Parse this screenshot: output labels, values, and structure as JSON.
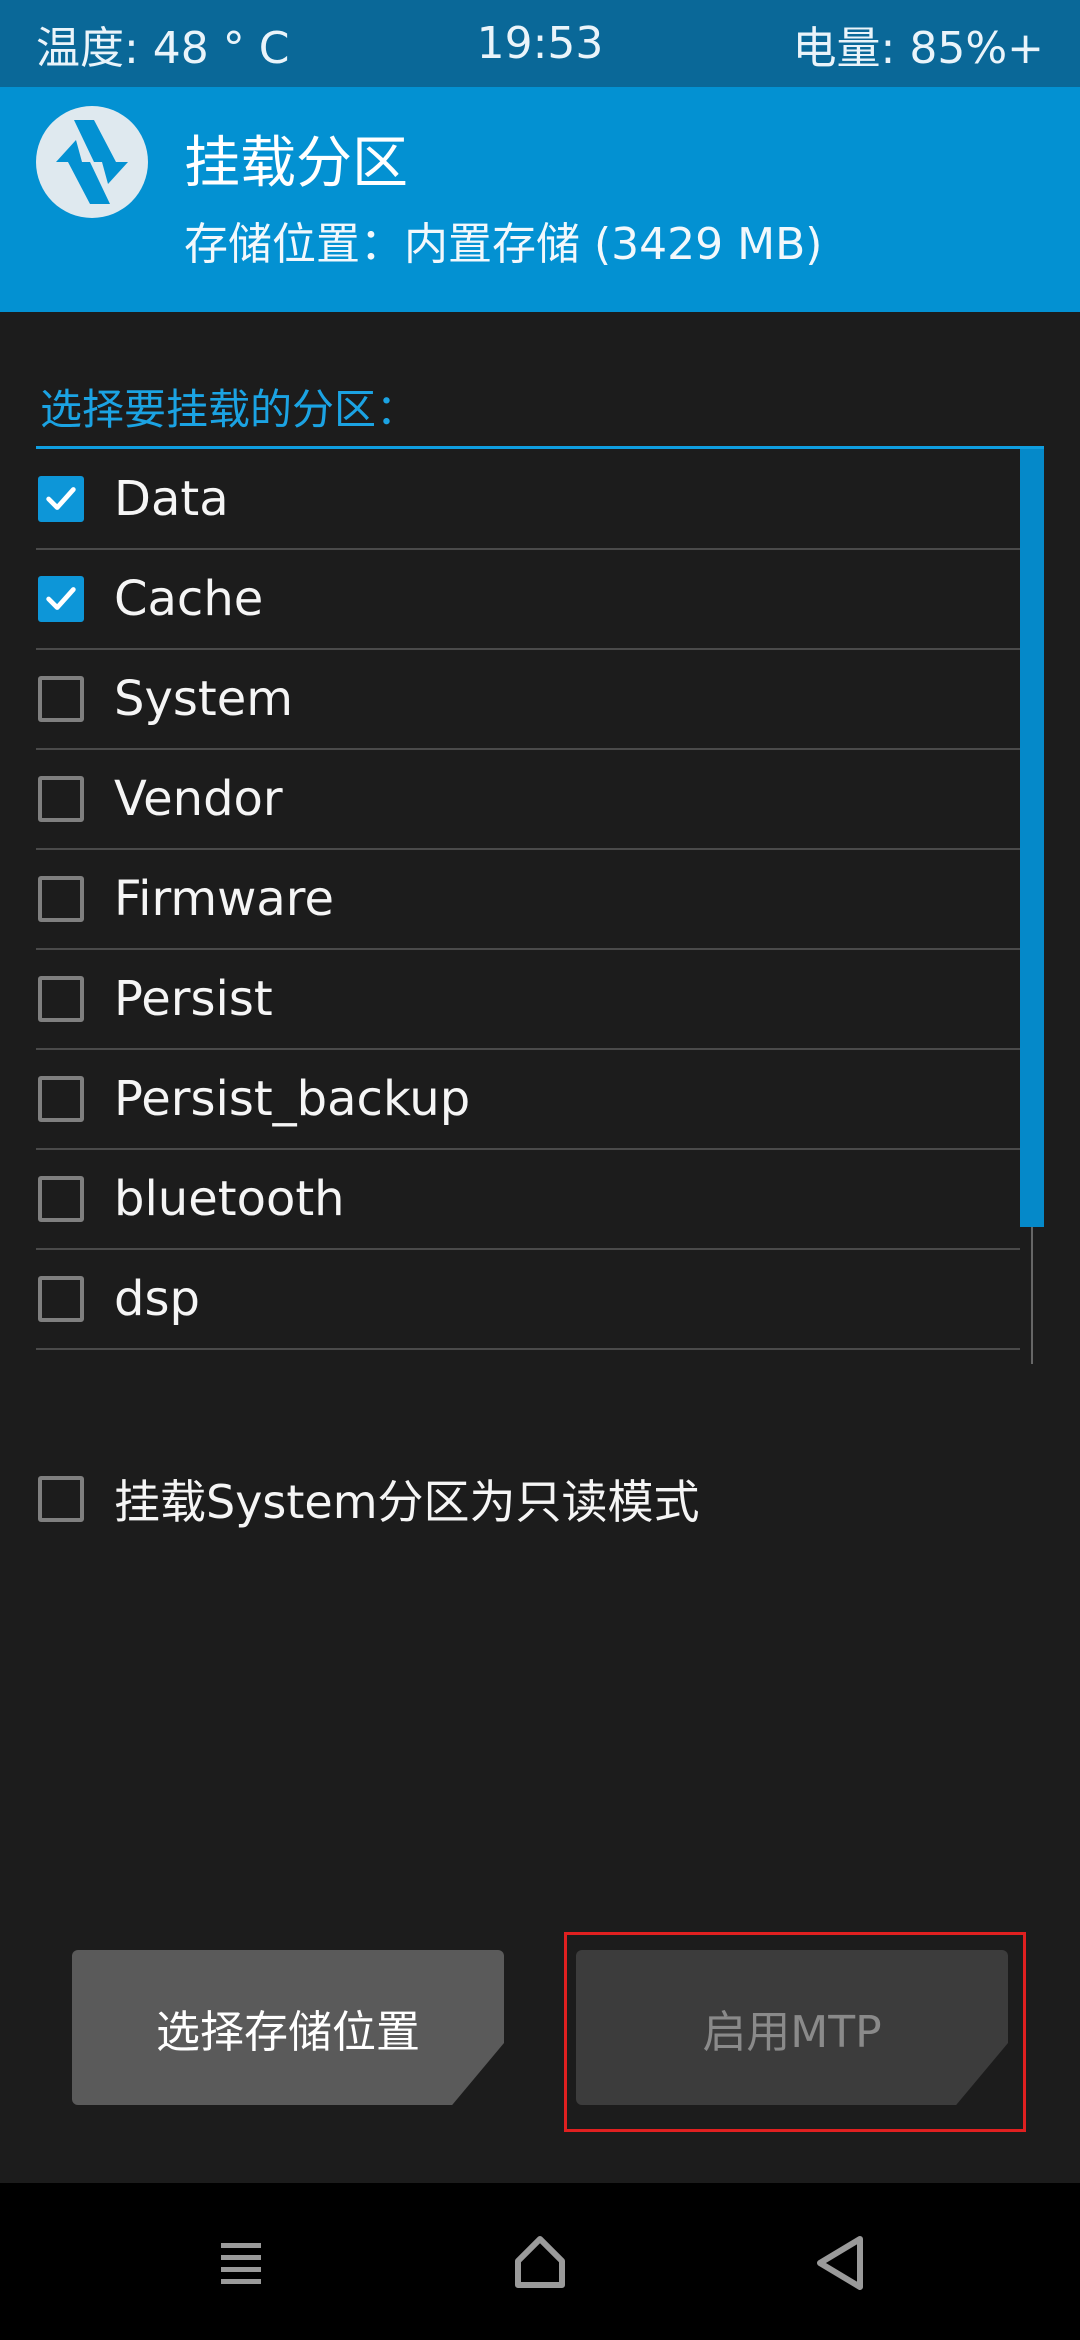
{
  "status": {
    "temperature": "温度: 48 ° C",
    "time": "19:53",
    "battery": "电量: 85%+"
  },
  "header": {
    "title": "挂载分区",
    "subtitle": "存储位置：内置存储 (3429 MB)"
  },
  "section_label": "选择要挂载的分区：",
  "partitions": [
    {
      "label": "Data",
      "checked": true
    },
    {
      "label": "Cache",
      "checked": true
    },
    {
      "label": "System",
      "checked": false
    },
    {
      "label": "Vendor",
      "checked": false
    },
    {
      "label": "Firmware",
      "checked": false
    },
    {
      "label": "Persist",
      "checked": false
    },
    {
      "label": "Persist_backup",
      "checked": false
    },
    {
      "label": "bluetooth",
      "checked": false
    },
    {
      "label": "dsp",
      "checked": false
    }
  ],
  "readonly_option": {
    "label": "挂载System分区为只读模式",
    "checked": false
  },
  "buttons": {
    "select_storage": "选择存储位置",
    "enable_mtp": "启用MTP"
  },
  "colors": {
    "accent": "#0391d2",
    "background": "#1c1c1c",
    "highlight": "#e02020"
  },
  "icons": {
    "logo": "twrp-logo-icon",
    "menu": "menu-icon",
    "home": "home-icon",
    "back": "back-icon"
  }
}
